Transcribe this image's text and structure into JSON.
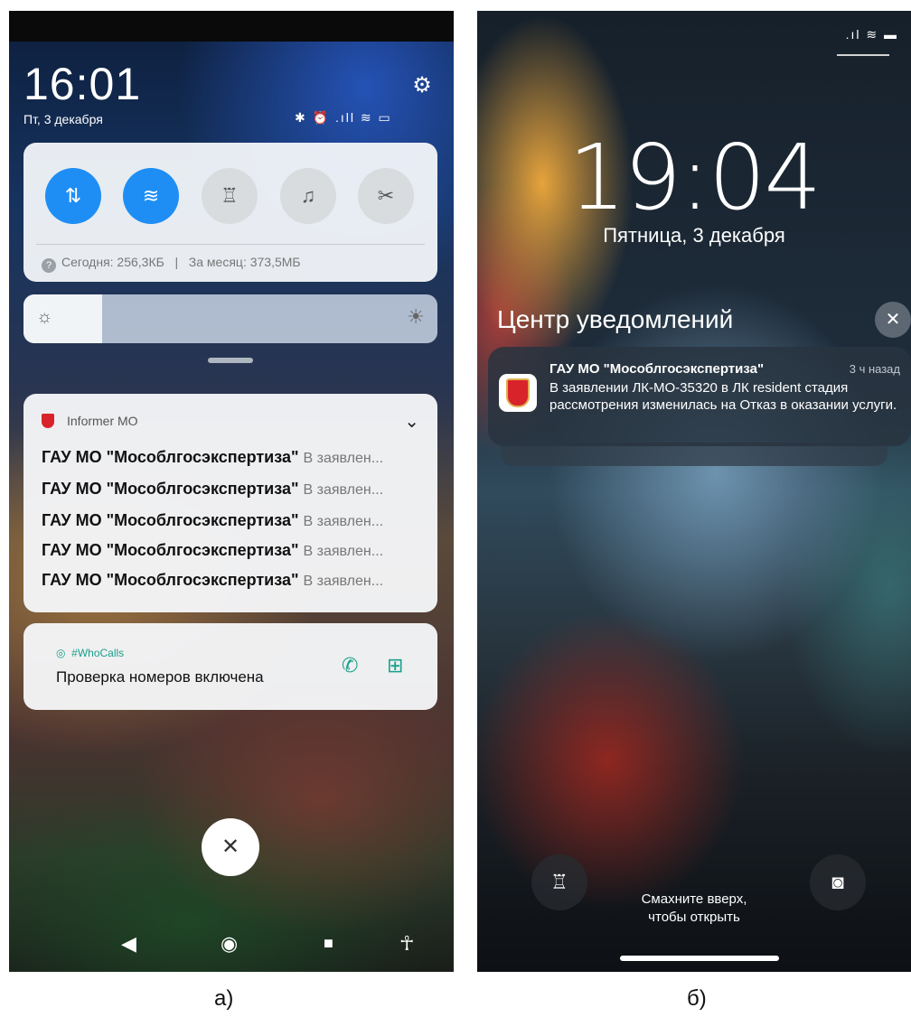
{
  "android": {
    "time": "16:01",
    "date": "Пт, 3 декабря",
    "status_icons": "✱ ⏰ .ıll ≋ ▭",
    "data_usage": {
      "today": "Сегодня: 256,3КБ",
      "separator": "|",
      "month": "За месяц: 373,5МБ"
    },
    "brightness_level": 0.19,
    "informer": {
      "app_name": "Informer MO",
      "rows": [
        {
          "title": "ГАУ МО \"Мособлгосэкспертиза\"",
          "body": "В заявлен..."
        },
        {
          "title": "ГАУ МО \"Мособлгосэкспертиза\"",
          "body": "В заявлен..."
        },
        {
          "title": "ГАУ МО \"Мособлгосэкспертиза\"",
          "body": "В заявлен..."
        },
        {
          "title": "ГАУ МО \"Мособлгосэкспертиза\"",
          "body": "В заявлен..."
        },
        {
          "title": "ГАУ МО \"Мособлгосэкспертиза\"",
          "body": "В заявлен..."
        }
      ]
    },
    "whocalls": {
      "app_name": "#WhoCalls",
      "text": "Проверка номеров включена"
    }
  },
  "ios": {
    "time": "19:04",
    "date": "Пятница, 3 декабря",
    "notification_center_title": "Центр уведомлений",
    "notification": {
      "title": "ГАУ МО \"Мособлгосэкспертиза\"",
      "time_ago": "3 ч назад",
      "body": "В заявлении ЛК-МО-35320 в ЛК resident стадия рассмотрения изменилась на Отказ в оказании услуги."
    },
    "swipe_line1": "Смахните вверх,",
    "swipe_line2": "чтобы открыть"
  },
  "captions": {
    "left": "а)",
    "right": "б)"
  },
  "colors": {
    "accent_blue": "#1e8ef5",
    "brand_red": "#d8232a",
    "whocalls_green": "#1a9e8a"
  }
}
